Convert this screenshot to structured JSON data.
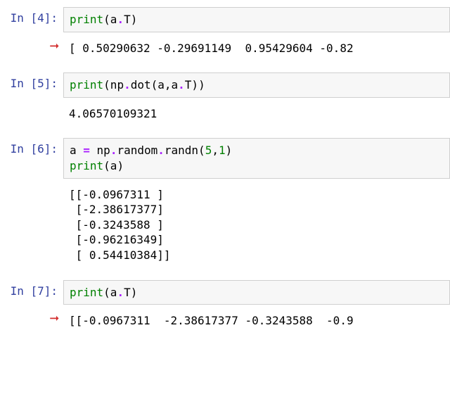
{
  "cells": [
    {
      "prompt": "In [4]:",
      "code_html": "<span class='py-builtin'>print</span>(a<span class='py-op'>.</span>T)",
      "arrow": true,
      "output": "[ 0.50290632 -0.29691149  0.95429604 -0.82"
    },
    {
      "prompt": "In [5]:",
      "code_html": "<span class='py-builtin'>print</span>(np<span class='py-op'>.</span>dot(a,a<span class='py-op'>.</span>T))",
      "arrow": false,
      "output": "4.06570109321"
    },
    {
      "prompt": "In [6]:",
      "code_html": "a <span class='py-op'>=</span> np<span class='py-op'>.</span>random<span class='py-op'>.</span>randn(<span style='color:#008000'>5</span>,<span style='color:#008000'>1</span>)\n<span class='py-builtin'>print</span>(a)",
      "arrow": false,
      "output": "[[-0.0967311 ]\n [-2.38617377]\n [-0.3243588 ]\n [-0.96216349]\n [ 0.54410384]]"
    },
    {
      "prompt": "In [7]:",
      "code_html": "<span class='py-builtin'>print</span>(a<span class='py-op'>.</span>T)",
      "arrow": true,
      "output": "[[-0.0967311  -2.38617377 -0.3243588  -0.9"
    }
  ]
}
